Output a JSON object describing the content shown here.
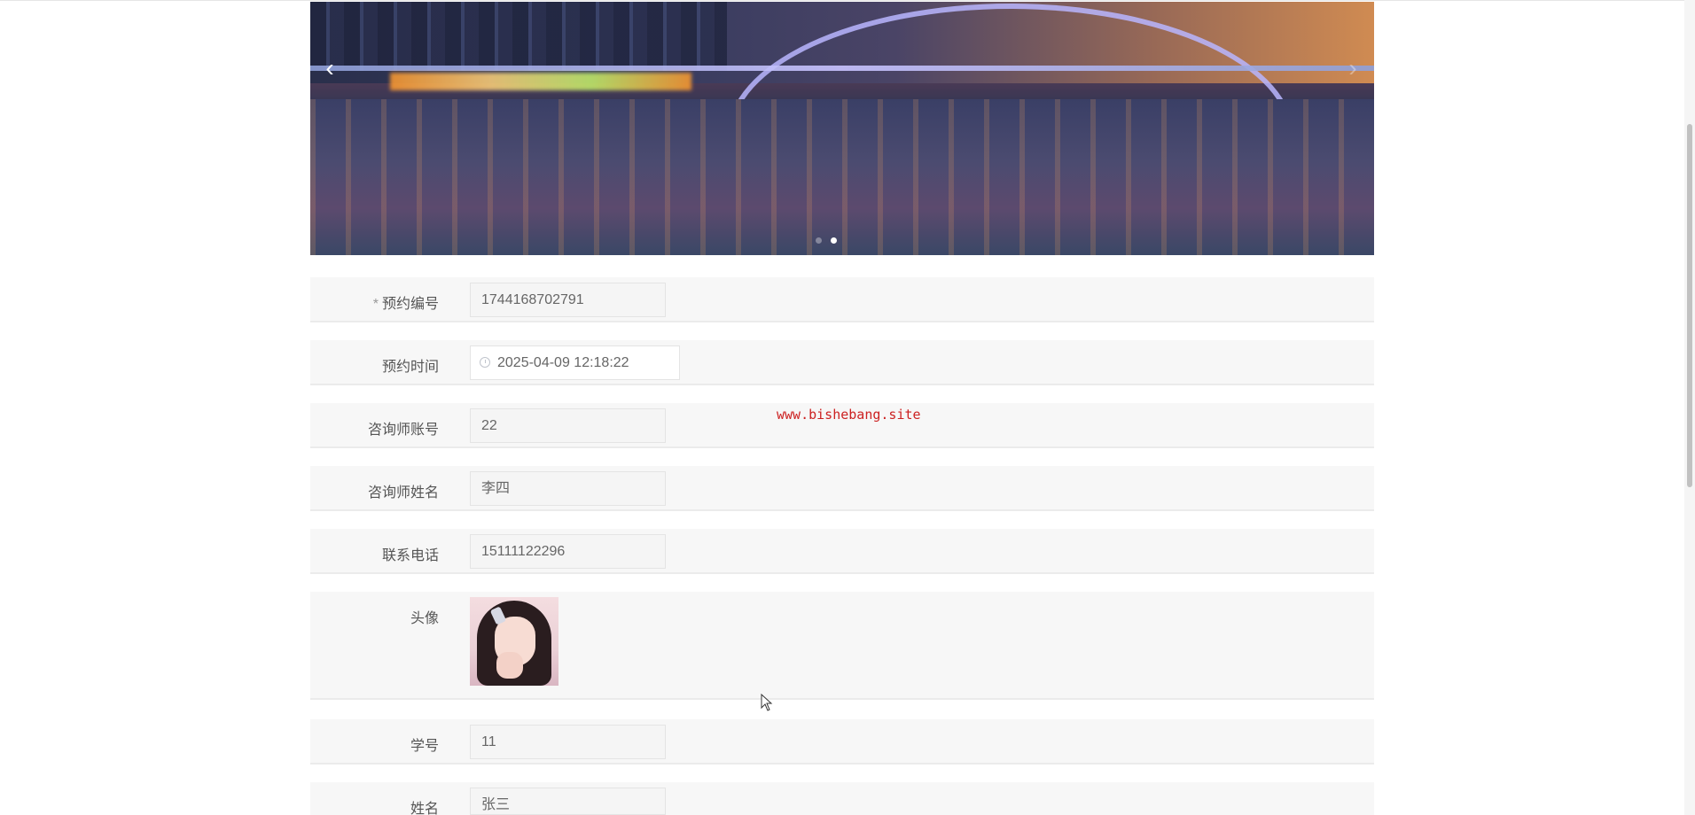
{
  "carousel": {
    "prev_icon": "chevron-left-icon",
    "next_icon": "chevron-right-icon",
    "dots": 2,
    "active_dot": 2
  },
  "form": {
    "fields": [
      {
        "label": "预约编号",
        "required": true,
        "value": "1744168702791"
      },
      {
        "label": "预约时间",
        "value": "2025-04-09 12:18:22"
      },
      {
        "label": "咨询师账号",
        "value": "22"
      },
      {
        "label": "咨询师姓名",
        "value": "李四"
      },
      {
        "label": "联系电话",
        "value": "15111122296"
      },
      {
        "label": "头像"
      },
      {
        "label": "学号",
        "value": "11"
      },
      {
        "label": "姓名",
        "value": "张三"
      }
    ],
    "required_mark": "*"
  },
  "watermark": "www.bishebang.site"
}
